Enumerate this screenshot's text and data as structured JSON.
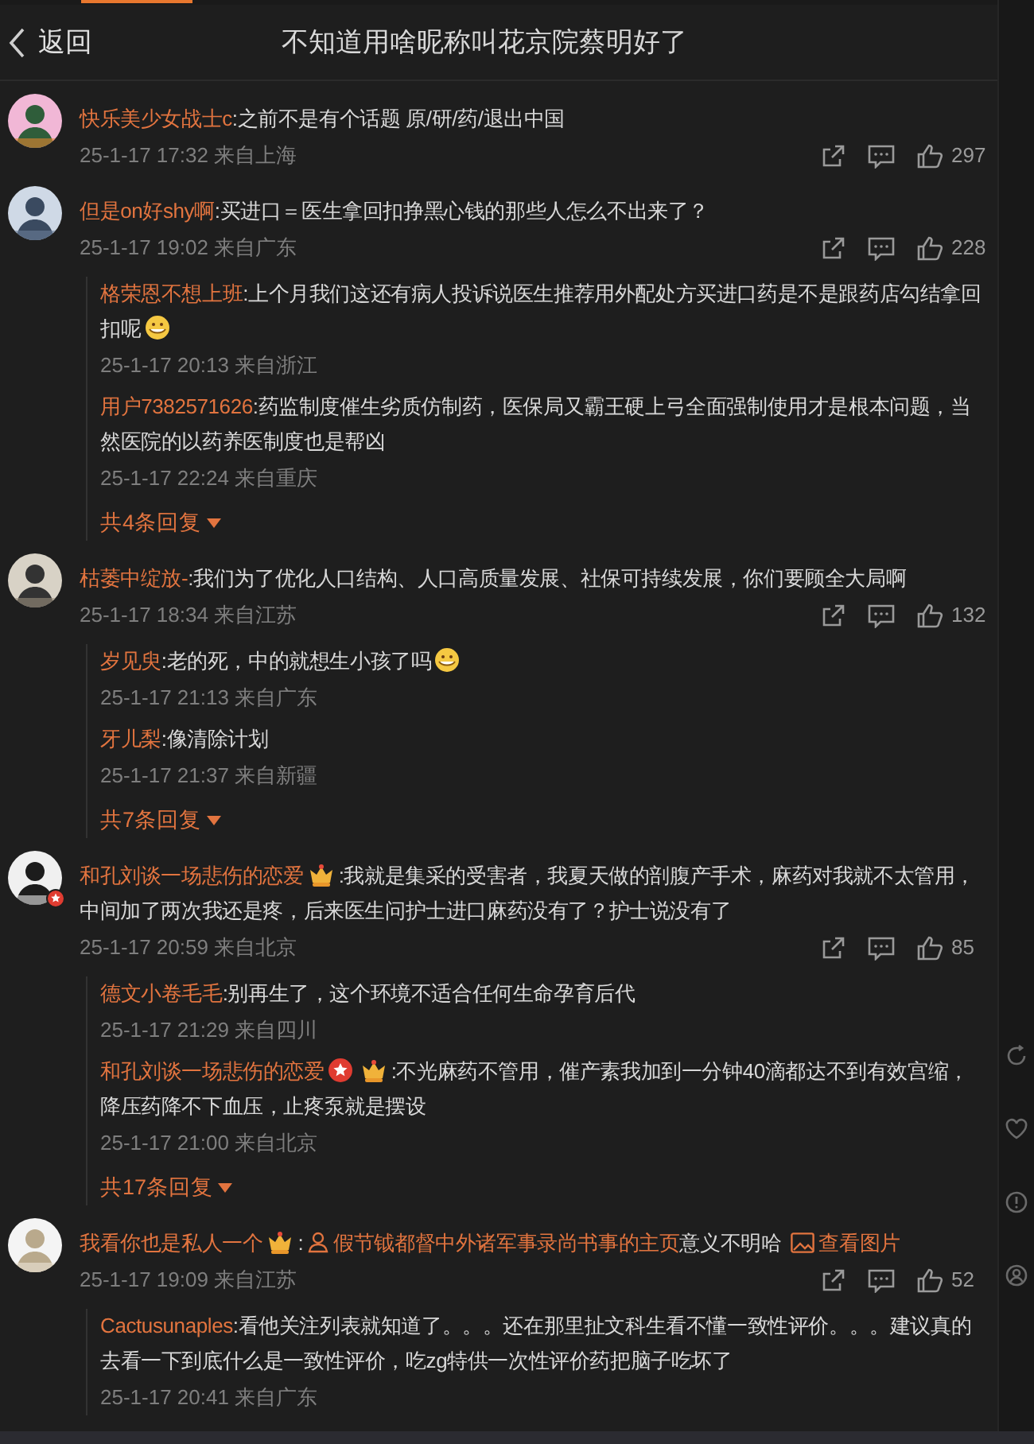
{
  "header": {
    "back": "返回",
    "title": "不知道用啥昵称叫花京院蔡明好了"
  },
  "comments": [
    {
      "author": "快乐美少女战士c",
      "avatar_badge": false,
      "crown": false,
      "medal": false,
      "body": [
        {
          "kind": "text",
          "text": ":之前不是有个话题 原/研/药/退出中国"
        }
      ],
      "time": "25-1-17 17:32 来自上海",
      "likes": "297"
    },
    {
      "author": "但是on好shy啊",
      "avatar_badge": false,
      "crown": false,
      "medal": false,
      "body": [
        {
          "kind": "text",
          "text": ":买进口＝医生拿回扣挣黑心钱的那些人怎么不出来了？"
        }
      ],
      "time": "25-1-17 19:02 来自广东",
      "likes": "228",
      "replies": [
        {
          "author": "格荣恩不想上班",
          "crown": false,
          "medal": false,
          "body": [
            {
              "kind": "text",
              "text": ":上个月我们这还有病人投诉说医生推荐用外配处方买进口药是不是跟药店勾结拿回扣呢"
            },
            {
              "kind": "emoji"
            }
          ],
          "time": "25-1-17 20:13 来自浙江"
        },
        {
          "author": "用户7382571626",
          "crown": false,
          "medal": false,
          "body": [
            {
              "kind": "text",
              "text": ":药监制度催生劣质仿制药，医保局又霸王硬上弓全面强制使用才是根本问题，当然医院的以药养医制度也是帮凶"
            }
          ],
          "time": "25-1-17 22:24 来自重庆"
        }
      ],
      "more": "共4条回复"
    },
    {
      "author": "枯萎中绽放-",
      "avatar_badge": false,
      "crown": false,
      "medal": false,
      "body": [
        {
          "kind": "text",
          "text": ":我们为了优化人口结构、人口高质量发展、社保可持续发展，你们要顾全大局啊"
        }
      ],
      "time": "25-1-17 18:34 来自江苏",
      "likes": "132",
      "replies": [
        {
          "author": "岁见臾",
          "crown": false,
          "medal": false,
          "body": [
            {
              "kind": "text",
              "text": ":老的死，中的就想生小孩了吗"
            },
            {
              "kind": "emoji"
            }
          ],
          "time": "25-1-17 21:13 来自广东"
        },
        {
          "author": "牙儿梨",
          "crown": false,
          "medal": false,
          "body": [
            {
              "kind": "text",
              "text": ":像清除计划"
            }
          ],
          "time": "25-1-17 21:37 来自新疆"
        }
      ],
      "more": "共7条回复"
    },
    {
      "author": "和孔刘谈一场悲伤的恋爱",
      "avatar_badge": true,
      "crown": true,
      "medal": false,
      "body": [
        {
          "kind": "text",
          "text": ":我就是集采的受害者，我夏天做的剖腹产手术，麻药对我就不太管用，中间加了两次我还是疼，后来医生问护士进口麻药没有了？护士说没有了"
        }
      ],
      "time": "25-1-17 20:59 来自北京",
      "likes": "85",
      "replies": [
        {
          "author": "德文小卷毛毛",
          "crown": false,
          "medal": false,
          "body": [
            {
              "kind": "text",
              "text": ":别再生了，这个环境不适合任何生命孕育后代"
            }
          ],
          "time": "25-1-17 21:29 来自四川"
        },
        {
          "author": "和孔刘谈一场悲伤的恋爱",
          "crown": true,
          "medal": true,
          "body": [
            {
              "kind": "text",
              "text": ":不光麻药不管用，催产素我加到一分钟40滴都达不到有效宫缩，降压药降不下血压，止疼泵就是摆设"
            }
          ],
          "time": "25-1-17 21:00 来自北京"
        }
      ],
      "more": "共17条回复"
    },
    {
      "author": "我看你也是私人一个",
      "avatar_badge": false,
      "crown": true,
      "medal": false,
      "body": [
        {
          "kind": "text",
          "text": ":"
        },
        {
          "kind": "profile_link",
          "text": "假节钺都督中外诸军事录尚书事的主页"
        },
        {
          "kind": "text",
          "text": "意义不明哈 "
        },
        {
          "kind": "image_link",
          "text": "查看图片"
        }
      ],
      "time": "25-1-17 19:09 来自江苏",
      "likes": "52",
      "replies": [
        {
          "author": "Cactusunaples",
          "crown": false,
          "medal": false,
          "body": [
            {
              "kind": "text",
              "text": ":看他关注列表就知道了。。。还在那里扯文科生看不懂一致性评价。。。建议真的去看一下到底什么是一致性评价，吃zg特供一次性评价药把脑子吃坏了"
            }
          ],
          "time": "25-1-17 20:41 来自广东"
        }
      ]
    }
  ]
}
